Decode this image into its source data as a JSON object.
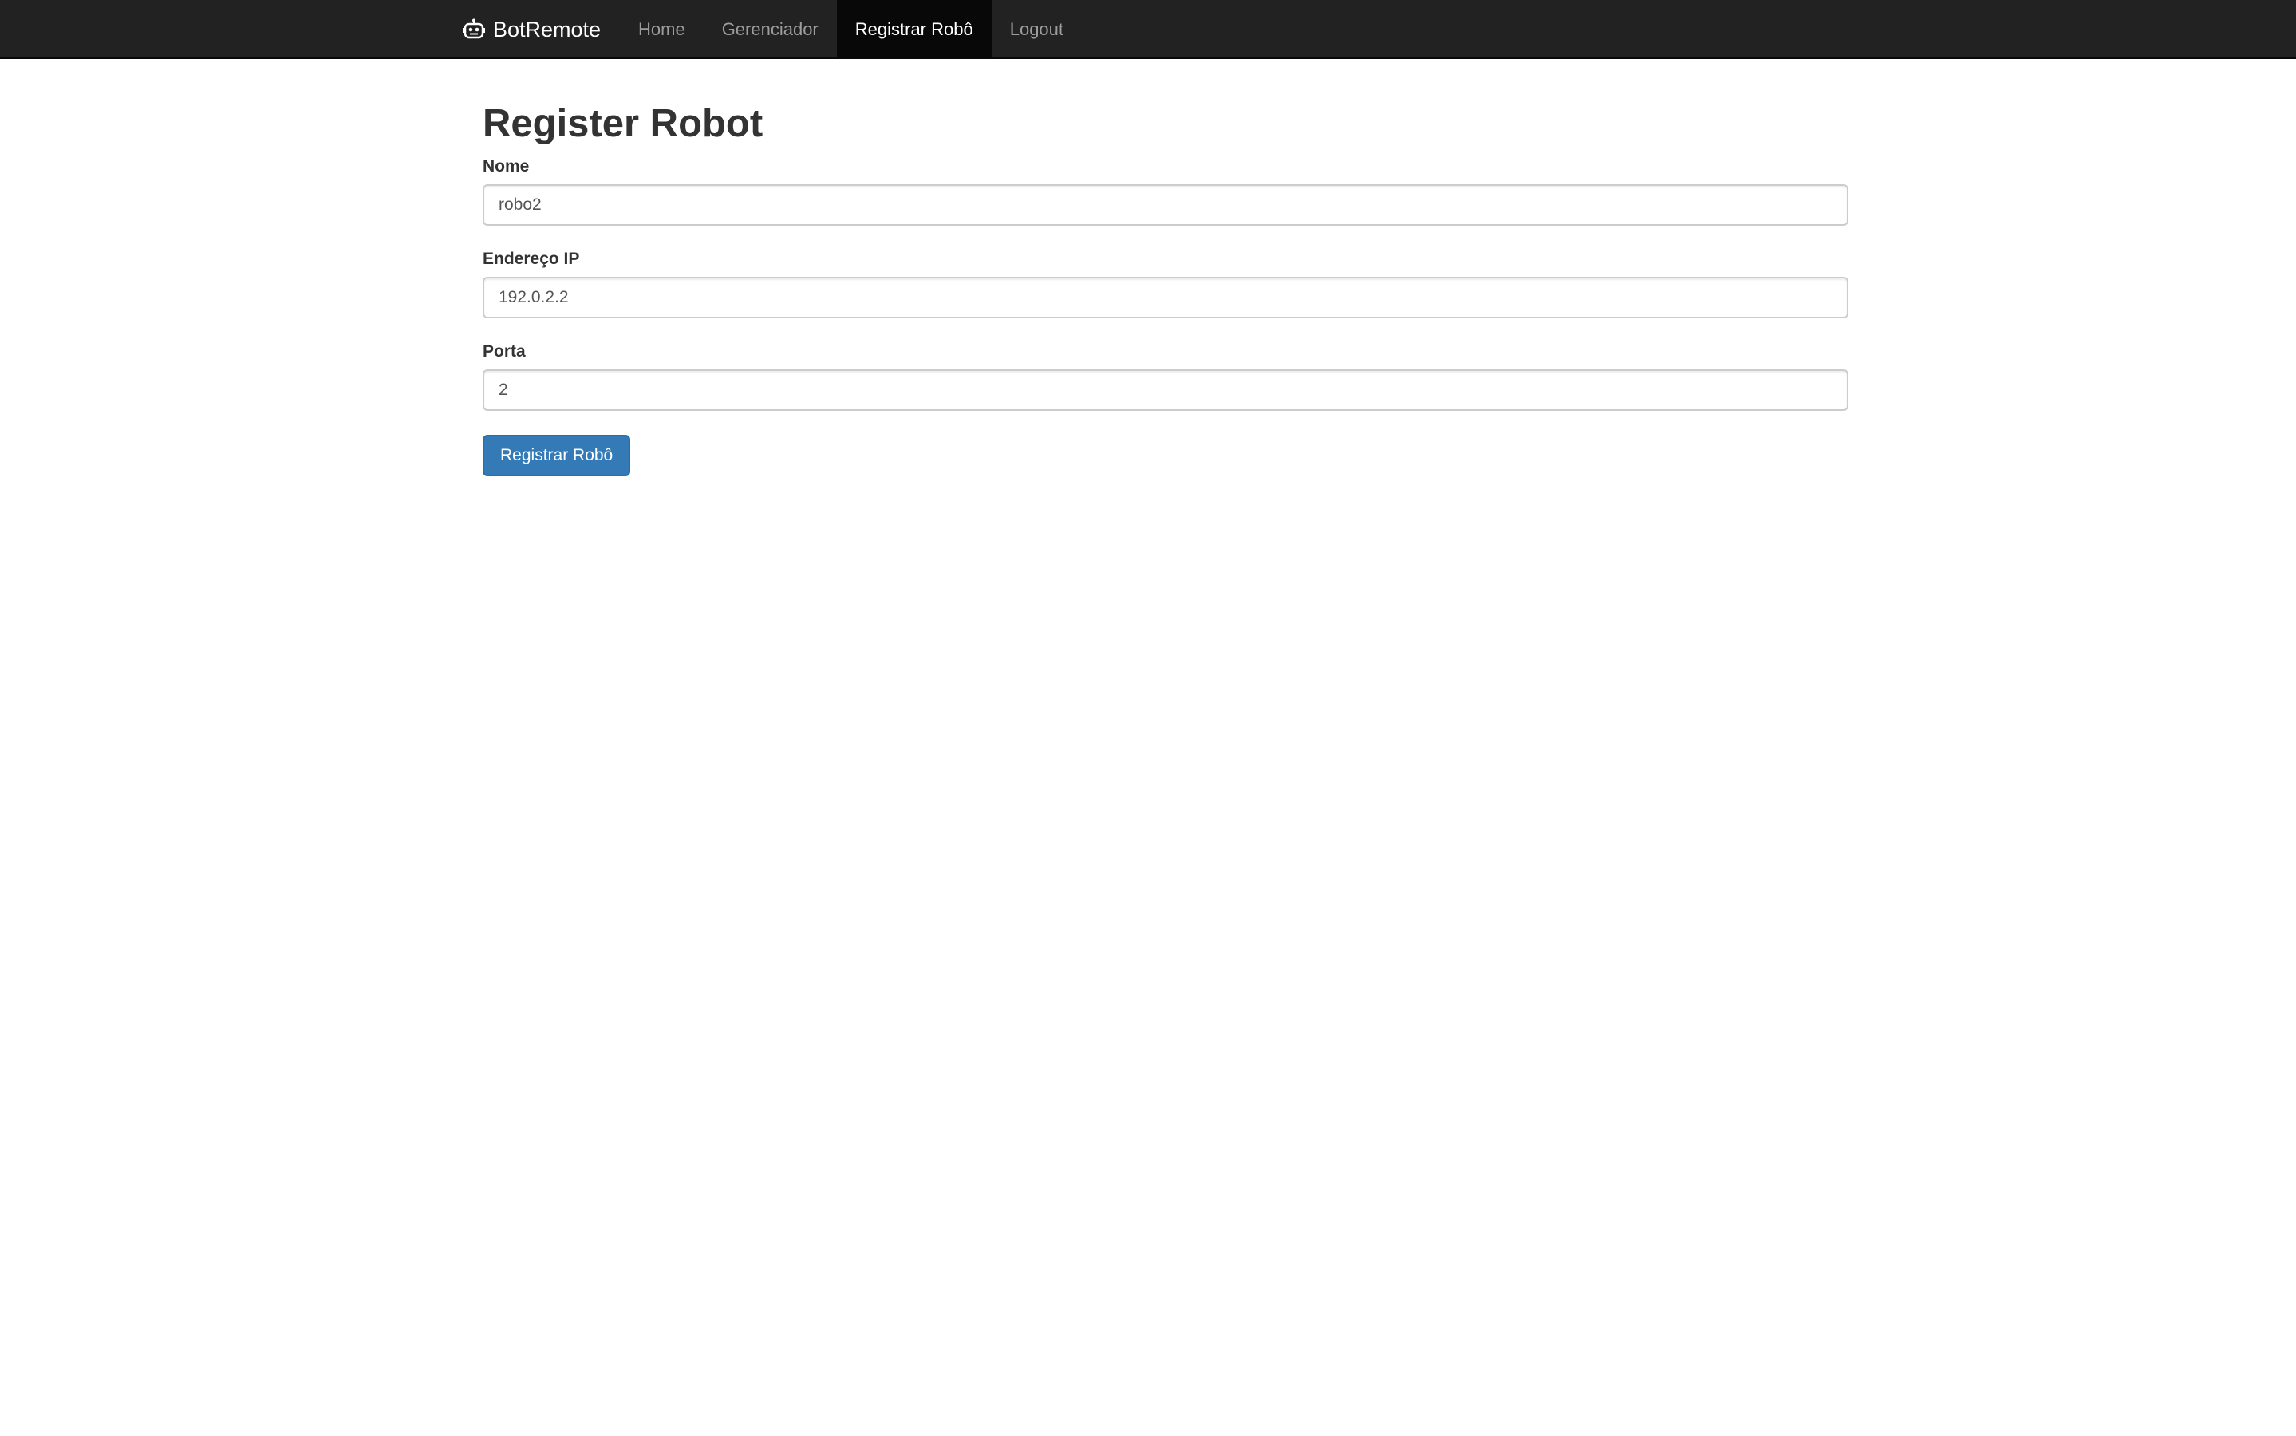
{
  "navbar": {
    "brand": "BotRemote",
    "brand_icon": "robot-icon",
    "items": [
      {
        "label": "Home",
        "active": false
      },
      {
        "label": "Gerenciador",
        "active": false
      },
      {
        "label": "Registrar Robô",
        "active": true
      },
      {
        "label": "Logout",
        "active": false
      }
    ],
    "colors": {
      "background": "#222222",
      "active_background": "#080808",
      "link": "#9d9d9d",
      "active_link": "#ffffff"
    }
  },
  "form": {
    "title": "Register Robot",
    "fields": [
      {
        "label": "Nome",
        "value": "robo2"
      },
      {
        "label": "Endereço IP",
        "value": "192.0.2.2"
      },
      {
        "label": "Porta",
        "value": "2"
      }
    ],
    "submit_label": "Registrar Robô",
    "colors": {
      "submit": "#337ab7"
    }
  }
}
